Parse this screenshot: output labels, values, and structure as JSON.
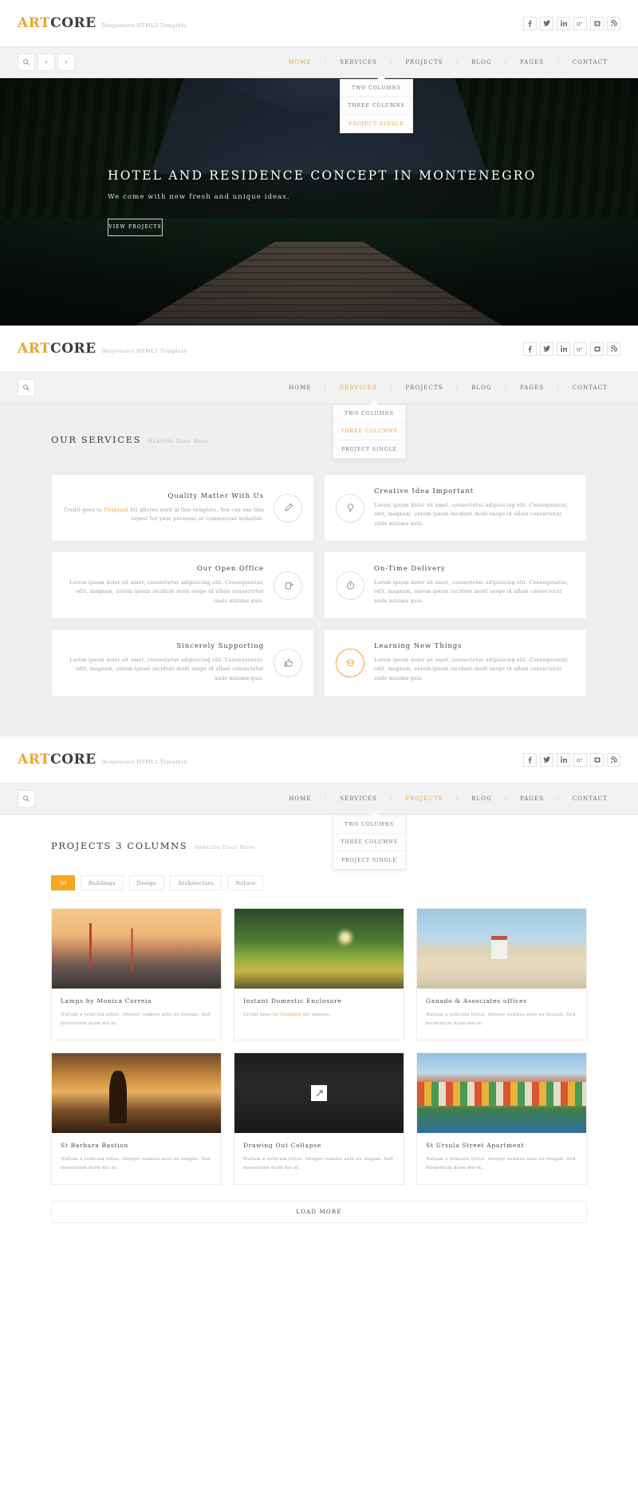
{
  "brand": {
    "part1": "ART",
    "part2": "CORE",
    "tagline": "Responsive HTML5 Template"
  },
  "socials": [
    {
      "name": "facebook-icon",
      "glyph": "f"
    },
    {
      "name": "twitter-icon",
      "glyph": "t"
    },
    {
      "name": "linkedin-icon",
      "glyph": "in"
    },
    {
      "name": "google-plus-icon",
      "glyph": "g+"
    },
    {
      "name": "behance-icon",
      "glyph": "B"
    },
    {
      "name": "rss-icon",
      "glyph": "r"
    }
  ],
  "nav": {
    "items": [
      "HOME",
      "SERVICES",
      "PROJECTS",
      "BLOG",
      "PAGES",
      "CONTACT"
    ],
    "separator": "/",
    "search_icon": "search-icon",
    "prev_icon": "chevron-left-icon",
    "next_icon": "chevron-right-icon"
  },
  "dropdown": {
    "items": [
      "TWO COLUMNS",
      "THREE COLUMNS",
      "PROJECT SINGLE"
    ]
  },
  "section1": {
    "active_nav": "HOME",
    "dropdown_active": "PROJECT SINGLE",
    "hero": {
      "title": "HOTEL AND RESIDENCE CONCEPT IN MONTENEGRO",
      "subtitle": "We come with new fresh and unique ideas.",
      "button": "VIEW PROJECTS"
    }
  },
  "section2": {
    "active_nav": "SERVICES",
    "dropdown_active": "THREE COLUMNS",
    "heading": "OUR SERVICES",
    "subheading": "Subtitle Goes Here",
    "cards": [
      {
        "title": "Quality Matter With Us",
        "text_before": "Credit goes to ",
        "link": "Unsplash",
        "text_after": " for photos used in this template. You can use this layout for your personal or commercial websites.",
        "icon": "pen-icon",
        "align": "right",
        "accent": false
      },
      {
        "title": "Creative Idea Important",
        "text": "Lorem ipsum dolor sit amet, consectetur adipisicing elit. Consequuntur, odit, magnam, autem ipsum incidunt modi saepe id ullam consectetur unde minima quis.",
        "icon": "lightbulb-icon",
        "align": "left",
        "accent": false
      },
      {
        "title": "Our Open Office",
        "text": "Lorem ipsum dolor sit amet, consectetur adipisicing elit. Consequuntur, odit, magnam, autem ipsum incidunt modi saepe id ullam consectetur unde minima quis.",
        "icon": "coffee-cup-icon",
        "align": "right",
        "accent": false
      },
      {
        "title": "On-Time Delivery",
        "text": "Lorem ipsum dolor sit amet, consectetur adipisicing elit. Consequuntur, odit, magnam, autem ipsum incidunt modi saepe id ullam consectetur unde minima quis.",
        "icon": "stopwatch-icon",
        "align": "left",
        "accent": false
      },
      {
        "title": "Sincerely Supporting",
        "text": "Lorem ipsum dolor sit amet, consectetur adipisicing elit. Consequuntur, odit, magnam, autem ipsum incidunt modi saepe id ullam consectetur unde minima quis.",
        "icon": "thumbs-up-icon",
        "align": "right",
        "accent": false
      },
      {
        "title": "Learning New Things",
        "text": "Lorem ipsum dolor sit amet, consectetur adipisicing elit. Consequuntur, odit, magnam, autem ipsum incidunt modi saepe id ullam consectetur unde minima quis.",
        "icon": "graduation-cap-icon",
        "align": "left",
        "accent": true
      }
    ]
  },
  "section3": {
    "active_nav": "PROJECTS",
    "heading": "PROJECTS 3 COLUMNS",
    "subheading": "Subtitle Goes Here",
    "filters": [
      {
        "label": "All",
        "active": true
      },
      {
        "label": "Buildings",
        "active": false
      },
      {
        "label": "Design",
        "active": false
      },
      {
        "label": "Architecture",
        "active": false
      },
      {
        "label": "Nature",
        "active": false
      }
    ],
    "projects": [
      {
        "title": "Lamps by Monica Correia",
        "text": "Nullam a vehicula tellus. Integer sodales ante eu feugiat. Sed fermentum diam dui et.",
        "thumb": "t-bridge",
        "hovered": false
      },
      {
        "title": "Instant Domestic Enclosure",
        "text_before": "Credit goes to ",
        "link": "Unsplash",
        "text_after": " for images.",
        "thumb": "t-field",
        "hovered": false
      },
      {
        "title": "Ganado & Associates offices",
        "text": "Nullam a vehicula tellus. Integer sodales ante eu feugiat. Sed fermentum diam dui et.",
        "thumb": "t-beach",
        "hovered": false
      },
      {
        "title": "St Barbara Bastion",
        "text": "Nullam a vehicula tellus. Integer sodales ante eu feugiat. Sed fermentum diam dui et.",
        "thumb": "t-sunset",
        "hovered": false
      },
      {
        "title": "Drawing Out Collapse",
        "text": "Nullam a vehicula tellus. Integer sodales ante eu feugiat. Sed fermentum diam dui et.",
        "thumb": "t-dark",
        "hovered": true
      },
      {
        "title": "St Ursula Street Apartment",
        "text": "Nullam a vehicula tellus. Integer sodales ante eu feugiat. Sed fermentum diam dui et.",
        "thumb": "t-houses",
        "hovered": false
      }
    ],
    "load_more": "LOAD MORE"
  },
  "colors": {
    "accent": "#f0a22e",
    "filter_active": "#f5a623",
    "text": "#555555",
    "band": "#efefef"
  }
}
